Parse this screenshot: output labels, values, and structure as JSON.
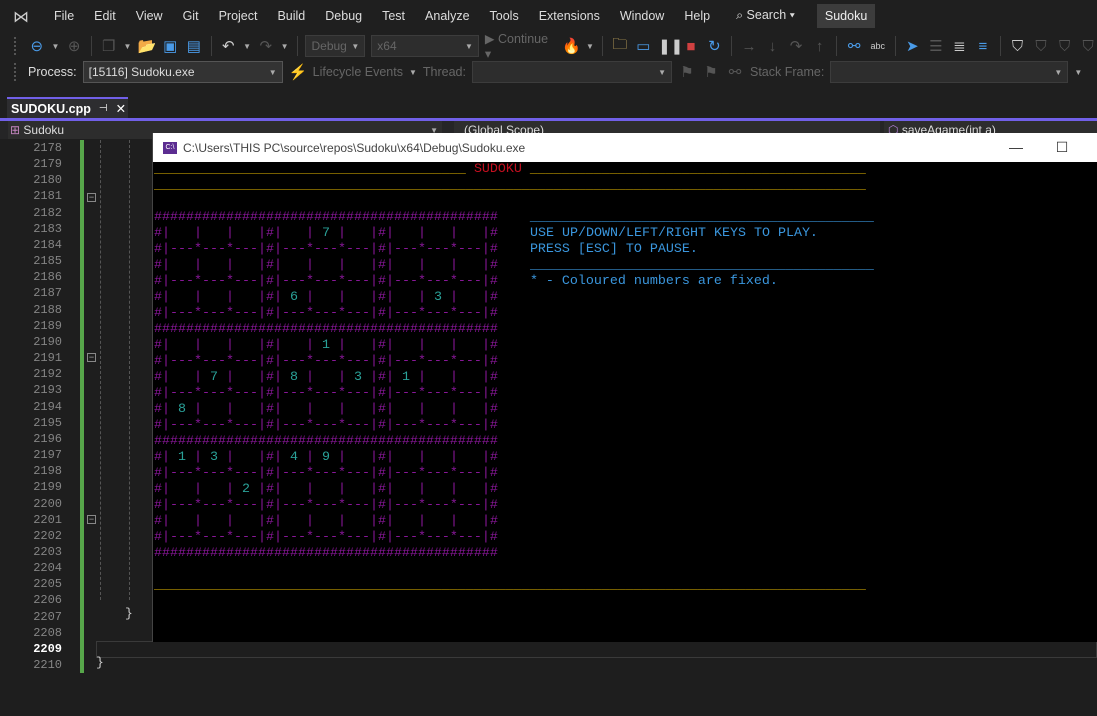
{
  "menubar": {
    "items": [
      "File",
      "Edit",
      "View",
      "Git",
      "Project",
      "Build",
      "Debug",
      "Test",
      "Analyze",
      "Tools",
      "Extensions",
      "Window",
      "Help"
    ],
    "search_label": "Search",
    "solution_title": "Sudoku"
  },
  "toolbar": {
    "configuration": "Debug",
    "platform": "x64",
    "continue_label": "Continue"
  },
  "debug_location": {
    "process_label": "Process:",
    "process_value": "[15116] Sudoku.exe",
    "lifecycle_label": "Lifecycle Events",
    "thread_label": "Thread:",
    "thread_value": "",
    "stack_frame_label": "Stack Frame:",
    "stack_frame_value": ""
  },
  "tab": {
    "label": "SUDOKU.cpp"
  },
  "navbar": {
    "project": "Sudoku",
    "scope": "(Global Scope)",
    "member": "saveAgame(int a)"
  },
  "editor": {
    "line_numbers": [
      "2178",
      "2179",
      "2180",
      "2181",
      "2182",
      "2183",
      "2184",
      "2185",
      "2186",
      "2187",
      "2188",
      "2189",
      "2190",
      "2191",
      "2192",
      "2193",
      "2194",
      "2195",
      "2196",
      "2197",
      "2198",
      "2199",
      "2200",
      "2201",
      "2202",
      "2203",
      "2204",
      "2205",
      "2206",
      "2207",
      "2208",
      "2209",
      "2210"
    ],
    "current_line": "2209",
    "closing_brace": "}"
  },
  "console": {
    "title": "C:\\Users\\THIS PC\\source\\repos\\Sudoku\\x64\\Debug\\Sudoku.exe",
    "icon_text": "C:\\",
    "heading": "SUDOKU",
    "instructions": [
      "USE UP/DOWN/LEFT/RIGHT KEYS TO PLAY.",
      "PRESS [ESC] TO PAUSE."
    ],
    "note": "* - Coloured numbers are fixed.",
    "grid": [
      [
        0,
        0,
        0,
        0,
        7,
        0,
        0,
        0,
        0
      ],
      [
        0,
        0,
        0,
        0,
        0,
        0,
        0,
        0,
        0
      ],
      [
        0,
        0,
        0,
        6,
        0,
        0,
        0,
        3,
        0
      ],
      [
        0,
        0,
        0,
        0,
        1,
        0,
        0,
        0,
        0
      ],
      [
        0,
        7,
        0,
        8,
        0,
        3,
        1,
        0,
        0
      ],
      [
        8,
        0,
        0,
        0,
        0,
        0,
        0,
        0,
        0
      ],
      [
        1,
        3,
        0,
        4,
        9,
        0,
        0,
        0,
        0
      ],
      [
        0,
        0,
        2,
        0,
        0,
        0,
        0,
        0,
        0
      ],
      [
        0,
        0,
        0,
        0,
        0,
        0,
        0,
        0,
        0
      ]
    ],
    "colors": {
      "grid": "#881798",
      "digits": "#2aa198",
      "lines": "#c19c00",
      "heading": "#c50f1f",
      "text": "#3a96dd"
    }
  }
}
